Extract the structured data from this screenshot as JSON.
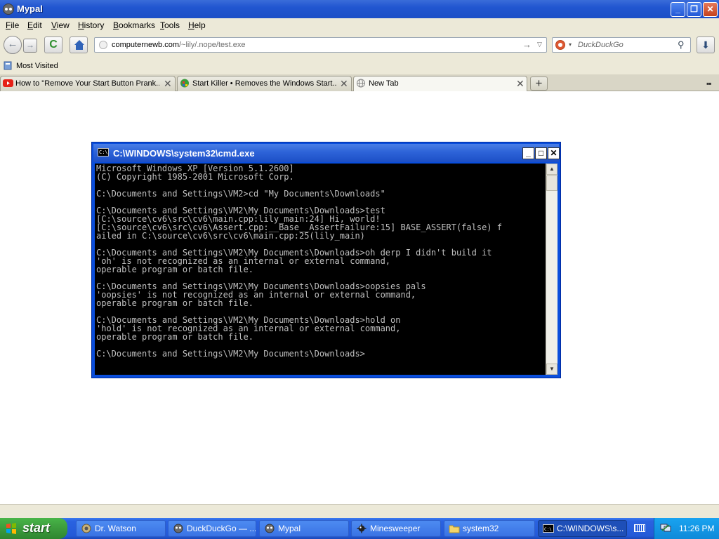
{
  "browser": {
    "title": "Mypal",
    "window_buttons": {
      "minimize": "_",
      "maximize": "❐",
      "close": "✕"
    }
  },
  "menu": [
    {
      "accel": "F",
      "rest": "ile"
    },
    {
      "accel": "E",
      "rest": "dit"
    },
    {
      "accel": "V",
      "rest": "iew"
    },
    {
      "accel": "H",
      "rest": "istory"
    },
    {
      "accel": "B",
      "rest": "ookmarks"
    },
    {
      "accel": "T",
      "rest": "ools"
    },
    {
      "accel": "H",
      "rest": "elp"
    }
  ],
  "nav": {
    "back_icon": "←",
    "forward_icon": "→",
    "reload_icon": "C",
    "url_domain": "computernewb.com",
    "url_path": "/~lily/.nope/test.exe",
    "go_icon": "→",
    "dropdown_icon": "▽",
    "search_placeholder": "DuckDuckGo",
    "search_dropdown_icon": "▾",
    "search_icon": "⚲",
    "download_icon": "⬇"
  },
  "bookmarks": {
    "most_visited": "Most Visited"
  },
  "tabs": [
    {
      "label": "How to \"Remove Your Start Button Prank...",
      "close": "✕",
      "favicon": "youtube-icon"
    },
    {
      "label": "Start Killer • Removes the Windows Start...",
      "close": "✕",
      "favicon": "start-killer-icon"
    },
    {
      "label": "New Tab",
      "close": "✕",
      "favicon": "globe-icon",
      "active": true
    }
  ],
  "new_tab_icon": "+",
  "tabs_list_icon": "▪▪",
  "cmd": {
    "title": "C:\\WINDOWS\\system32\\cmd.exe",
    "min": "_",
    "max": "□",
    "close": "✕",
    "icon_text": "C:\\",
    "scroll_up": "▲",
    "scroll_down": "▼",
    "text": "Microsoft Windows XP [Version 5.1.2600]\n(C) Copyright 1985-2001 Microsoft Corp.\n\nC:\\Documents and Settings\\VM2>cd \"My Documents\\Downloads\"\n\nC:\\Documents and Settings\\VM2\\My Documents\\Downloads>test\n[C:\\source\\cv6\\src\\cv6\\main.cpp:lily_main:24] Hi, world!\n[C:\\source\\cv6\\src\\cv6\\Assert.cpp:__Base__AssertFailure:15] BASE_ASSERT(false) f\nailed in C:\\source\\cv6\\src\\cv6\\main.cpp:25(lily_main)\n\nC:\\Documents and Settings\\VM2\\My Documents\\Downloads>oh derp I didn't build it\n'oh' is not recognized as an internal or external command,\noperable program or batch file.\n\nC:\\Documents and Settings\\VM2\\My Documents\\Downloads>oopsies pals\n'oopsies' is not recognized as an internal or external command,\noperable program or batch file.\n\nC:\\Documents and Settings\\VM2\\My Documents\\Downloads>hold on\n'hold' is not recognized as an internal or external command,\noperable program or batch file.\n\nC:\\Documents and Settings\\VM2\\My Documents\\Downloads>"
  },
  "taskbar": {
    "start_label": "start",
    "tasks": [
      {
        "label": "Dr. Watson",
        "icon": "dr-watson-icon"
      },
      {
        "label": "DuckDuckGo — ...",
        "icon": "mypal-icon"
      },
      {
        "label": "Mypal",
        "icon": "mypal-icon"
      },
      {
        "label": "Minesweeper",
        "icon": "minesweeper-icon"
      },
      {
        "label": "system32",
        "icon": "folder-icon"
      },
      {
        "label": "C:\\WINDOWS\\s...",
        "icon": "cmd-icon",
        "active": true
      }
    ],
    "clock": "11:26 PM"
  },
  "colors": {
    "xp_blue": "#245ad8",
    "start_green": "#3c9b3c",
    "tray_blue": "#0f8ad9",
    "chrome_beige": "#ece9d8",
    "console_text": "#c0c0c0"
  }
}
